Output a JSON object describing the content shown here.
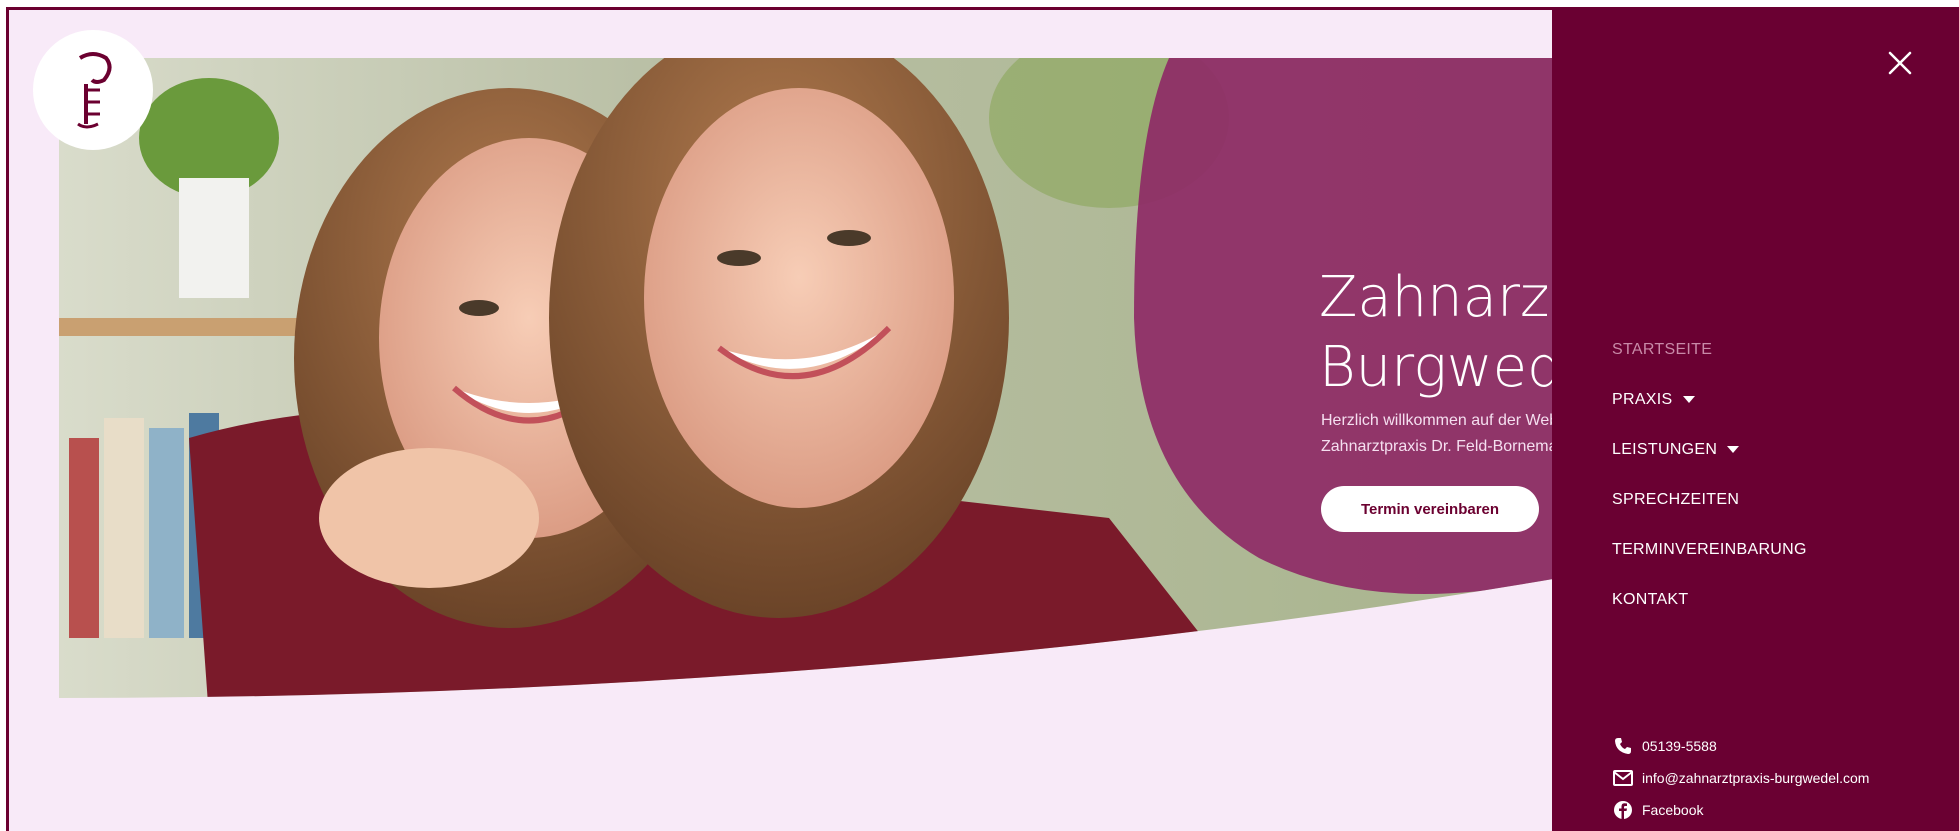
{
  "hero": {
    "title_line1": "Zahnarztpraxis",
    "title_line2": "Burgwedel",
    "text_line1": "Herzlich willkommen auf der Website der",
    "text_line2": "Zahnarztpraxis Dr. Feld-Bornemann in Burgwedel",
    "cta_label": "Termin vereinbaren"
  },
  "menu": {
    "items": [
      {
        "label": "STARTSEITE",
        "active": true
      },
      {
        "label": "PRAXIS",
        "dropdown": true
      },
      {
        "label": "LEISTUNGEN",
        "dropdown": true
      },
      {
        "label": "SPRECHZEITEN"
      },
      {
        "label": "TERMINVEREINBARUNG"
      },
      {
        "label": "KONTAKT"
      }
    ],
    "close_icon": "close-icon"
  },
  "contact": {
    "phone": "05139-5588",
    "email": "info@zahnarztpraxis-burgwedel.com",
    "facebook": "Facebook"
  },
  "colors": {
    "brand": "#6a0032",
    "background": "#f8eaf8",
    "overlay": "#8e2a66"
  }
}
